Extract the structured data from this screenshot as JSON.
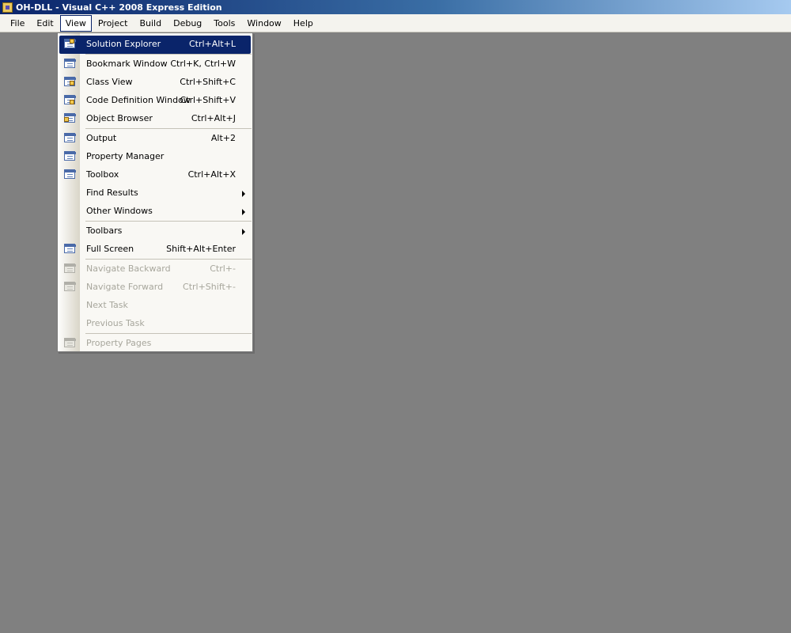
{
  "window": {
    "title": "OH-DLL - Visual C++ 2008 Express Edition"
  },
  "menubar": {
    "items": [
      {
        "label": "File"
      },
      {
        "label": "Edit"
      },
      {
        "label": "View"
      },
      {
        "label": "Project"
      },
      {
        "label": "Build"
      },
      {
        "label": "Debug"
      },
      {
        "label": "Tools"
      },
      {
        "label": "Window"
      },
      {
        "label": "Help"
      }
    ]
  },
  "view_menu": {
    "items": [
      {
        "label": "Solution Explorer",
        "shortcut": "Ctrl+Alt+L",
        "icon": "solution-explorer-icon",
        "selected": true
      },
      {
        "separator": true
      },
      {
        "label": "Bookmark Window",
        "shortcut": "Ctrl+K, Ctrl+W",
        "icon": "bookmark-window-icon"
      },
      {
        "label": "Class View",
        "shortcut": "Ctrl+Shift+C",
        "icon": "class-view-icon"
      },
      {
        "label": "Code Definition Window",
        "shortcut": "Ctrl+Shift+V",
        "icon": "code-definition-icon"
      },
      {
        "label": "Object Browser",
        "shortcut": "Ctrl+Alt+J",
        "icon": "object-browser-icon"
      },
      {
        "separator": true
      },
      {
        "label": "Output",
        "shortcut": "Alt+2",
        "icon": "output-icon"
      },
      {
        "label": "Property Manager",
        "shortcut": "",
        "icon": "property-manager-icon"
      },
      {
        "label": "Toolbox",
        "shortcut": "Ctrl+Alt+X",
        "icon": "toolbox-icon"
      },
      {
        "label": "Find Results",
        "shortcut": "",
        "submenu": true
      },
      {
        "label": "Other Windows",
        "shortcut": "",
        "submenu": true
      },
      {
        "separator": true
      },
      {
        "label": "Toolbars",
        "shortcut": "",
        "submenu": true
      },
      {
        "label": "Full Screen",
        "shortcut": "Shift+Alt+Enter",
        "icon": "full-screen-icon"
      },
      {
        "separator": true
      },
      {
        "label": "Navigate Backward",
        "shortcut": "Ctrl+-",
        "icon": "navigate-backward-icon",
        "disabled": true
      },
      {
        "label": "Navigate Forward",
        "shortcut": "Ctrl+Shift+-",
        "icon": "navigate-forward-icon",
        "disabled": true
      },
      {
        "label": "Next Task",
        "shortcut": "",
        "disabled": true
      },
      {
        "label": "Previous Task",
        "shortcut": "",
        "disabled": true
      },
      {
        "separator": true
      },
      {
        "label": "Property Pages",
        "shortcut": "",
        "icon": "property-pages-icon",
        "disabled": true
      }
    ]
  },
  "colors": {
    "workspace": "#808080",
    "highlight": "#0a246a",
    "menu_background": "#f9f8f4",
    "disabled_text": "#a7a69c"
  }
}
